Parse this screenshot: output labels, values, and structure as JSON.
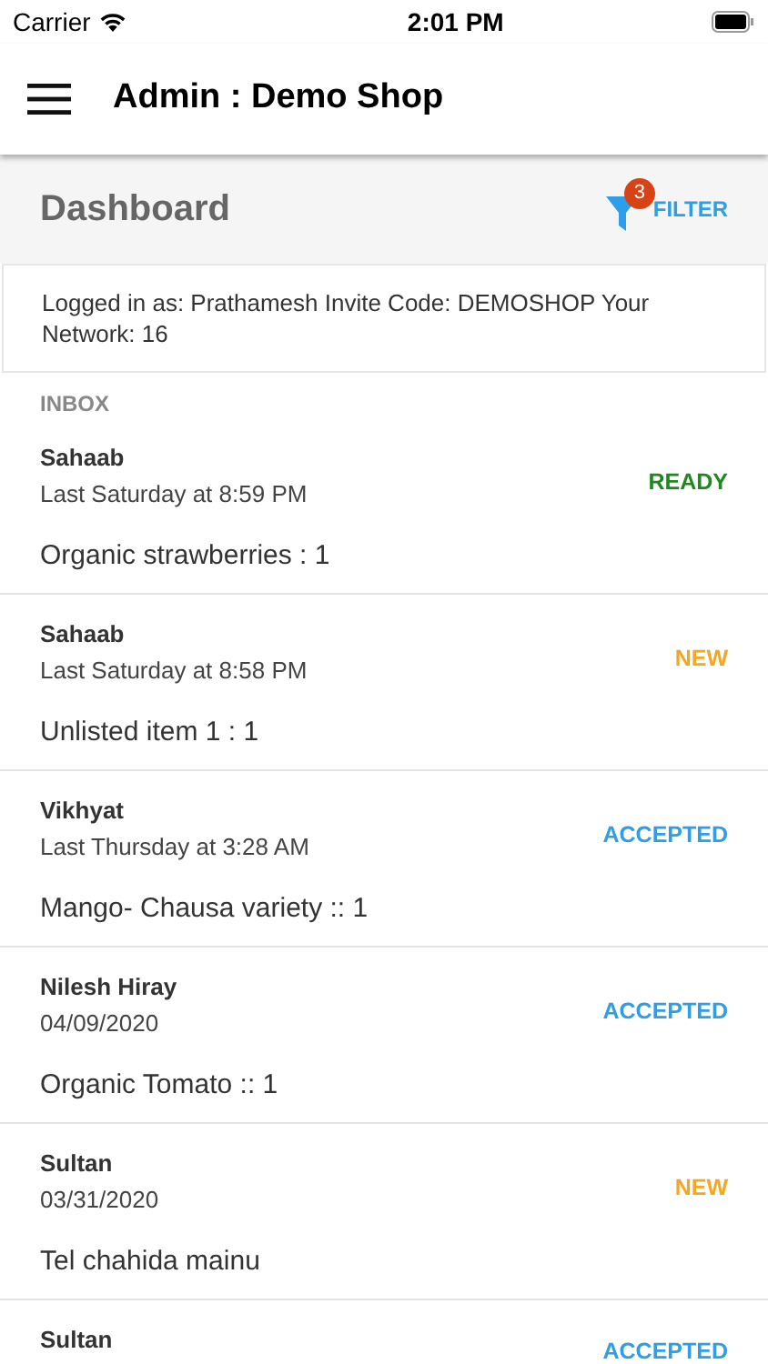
{
  "status_bar": {
    "carrier": "Carrier",
    "time": "2:01 PM"
  },
  "header": {
    "title": "Admin : Demo Shop"
  },
  "dashboard": {
    "title": "Dashboard",
    "filter_label": "FILTER",
    "filter_count": "3"
  },
  "info": "Logged in as: Prathamesh Invite Code: DEMOSHOP Your Network: 16",
  "inbox": {
    "label": "INBOX",
    "orders": [
      {
        "name": "Sahaab",
        "time": "Last Saturday at 8:59 PM",
        "item": "Organic strawberries : 1",
        "status": "READY",
        "kind": "ready"
      },
      {
        "name": "Sahaab",
        "time": "Last Saturday at 8:58 PM",
        "item": "Unlisted item 1 : 1",
        "status": "NEW",
        "kind": "new"
      },
      {
        "name": "Vikhyat",
        "time": "Last Thursday at 3:28 AM",
        "item": "Mango- Chausa variety :: 1",
        "status": "ACCEPTED",
        "kind": "accepted"
      },
      {
        "name": "Nilesh Hiray",
        "time": "04/09/2020",
        "item": "Organic Tomato :: 1",
        "status": "ACCEPTED",
        "kind": "accepted"
      },
      {
        "name": "Sultan",
        "time": "03/31/2020",
        "item": "Tel chahida mainu",
        "status": "NEW",
        "kind": "new"
      },
      {
        "name": "Sultan",
        "status": "ACCEPTED",
        "kind": "accepted"
      }
    ]
  }
}
